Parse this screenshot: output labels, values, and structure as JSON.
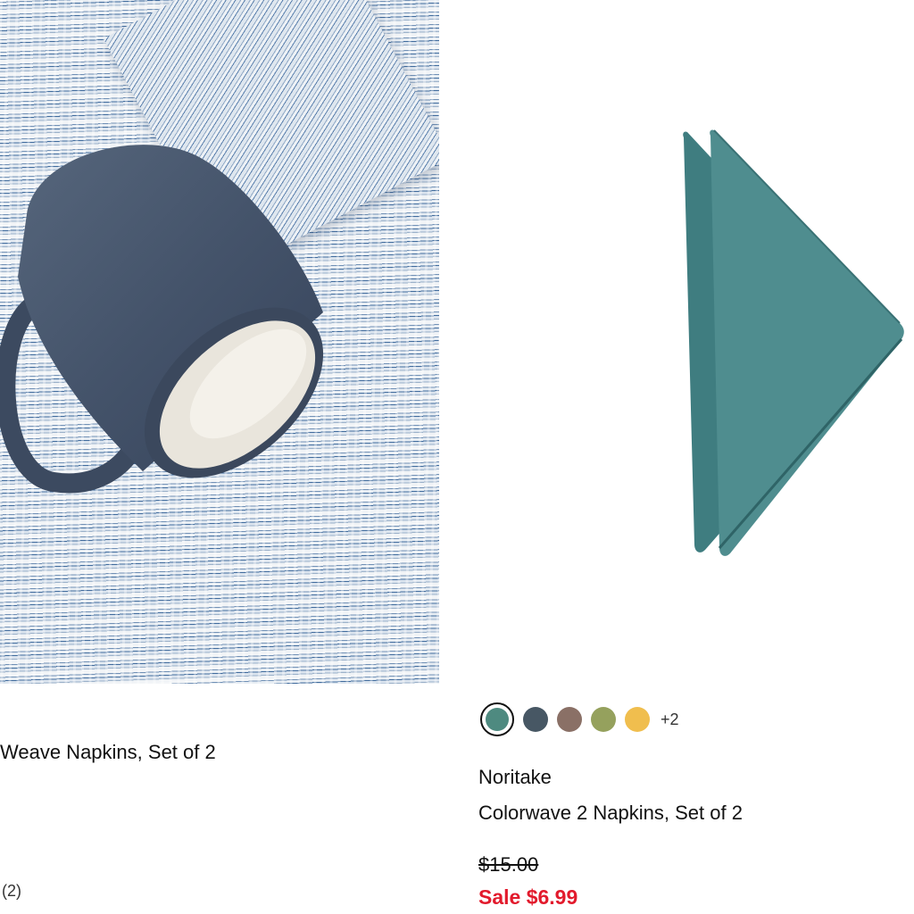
{
  "products": [
    {
      "title": "Weave Napkins, Set of 2",
      "reviews": "(2)"
    },
    {
      "brand": "Noritake",
      "title": "Colorwave 2 Napkins, Set of 2",
      "original_price": "$15.00",
      "sale_price": "Sale $6.99",
      "sale_color": "#e21a2c",
      "swatches": [
        {
          "name": "teal",
          "color": "#4e8a80",
          "selected": true
        },
        {
          "name": "slate",
          "color": "#475764",
          "selected": false
        },
        {
          "name": "mocha",
          "color": "#8a7066",
          "selected": false
        },
        {
          "name": "olive",
          "color": "#95a15d",
          "selected": false
        },
        {
          "name": "mustard",
          "color": "#f0be4e",
          "selected": false
        }
      ],
      "more_colors": "+2"
    }
  ]
}
